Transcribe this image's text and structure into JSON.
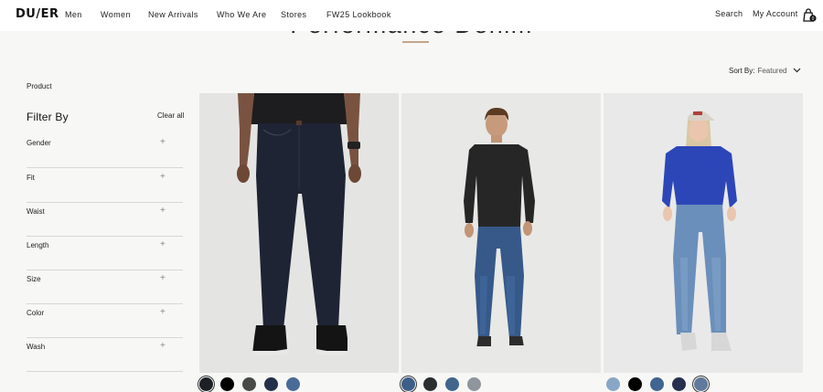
{
  "header": {
    "logo": "DU/ER",
    "nav": [
      "Men",
      "Women",
      "New Arrivals",
      "Who We Are",
      "Stores",
      "FW25 Lookbook"
    ],
    "search": "Search",
    "account": "My Account",
    "cart_count": "0"
  },
  "hero": {
    "title": "Performance Denim"
  },
  "sort": {
    "label": "Sort By:",
    "value": "Featured"
  },
  "breadcrumb": "Product",
  "filters": {
    "title": "Filter By",
    "clear_all": "Clear all",
    "groups": [
      "Gender",
      "Fit",
      "Waist",
      "Length",
      "Size",
      "Color",
      "Wash"
    ],
    "expand_symbol": "+"
  },
  "products": [
    {
      "image": "dark-raw-denim-black-tee-sneakers",
      "swatch_colors": [
        "#1c1f24",
        "#000000",
        "#474945",
        "#23304a",
        "#4a6a98"
      ],
      "selected_swatch": 0
    },
    {
      "image": "mid-blue-denim-black-pullover",
      "swatch_colors": [
        "#3e5e8a",
        "#2a2e30",
        "#41658c",
        "#8f959c"
      ],
      "selected_swatch": 0
    },
    {
      "image": "light-blue-denim-blue-sweatshirt-cap",
      "swatch_colors": [
        "#8aa6c6",
        "#000000",
        "#3f6590",
        "#27304e",
        "#60799c"
      ],
      "selected_swatch": 4
    }
  ]
}
